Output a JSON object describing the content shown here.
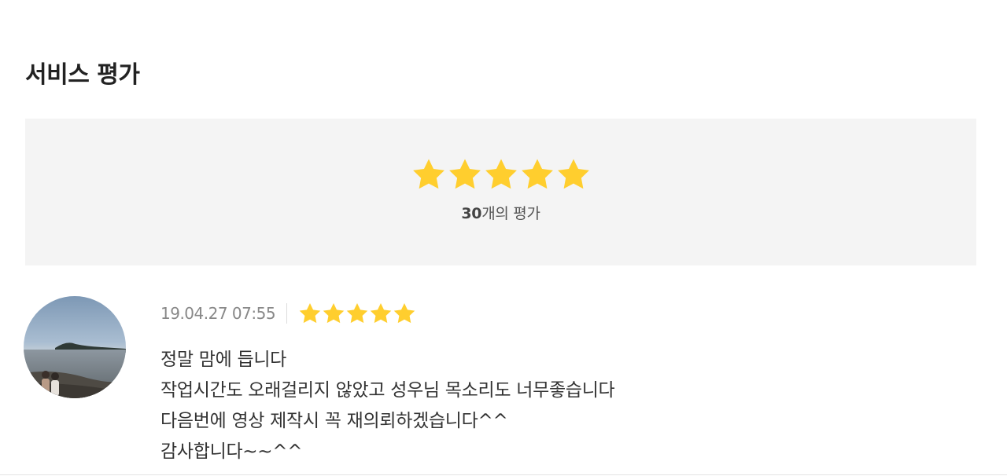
{
  "section": {
    "title": "서비스 평가"
  },
  "summary": {
    "rating": 5,
    "max_rating": 5,
    "count": "30",
    "count_suffix": "개의 평가"
  },
  "reviews": [
    {
      "datetime": "19.04.27 07:55",
      "rating": 5,
      "lines": [
        "정말 맘에 듭니다",
        "작업시간도 오래걸리지 않았고 성우님 목소리도 너무좋습니다",
        "다음번에 영상 제작시 꼭 재의뢰하겠습니다^^",
        "감사합니다~~^^"
      ]
    }
  ],
  "colors": {
    "star": "#FFCE2E",
    "summary_bg": "#F4F4F4"
  },
  "icons": {
    "star": "star-icon"
  }
}
